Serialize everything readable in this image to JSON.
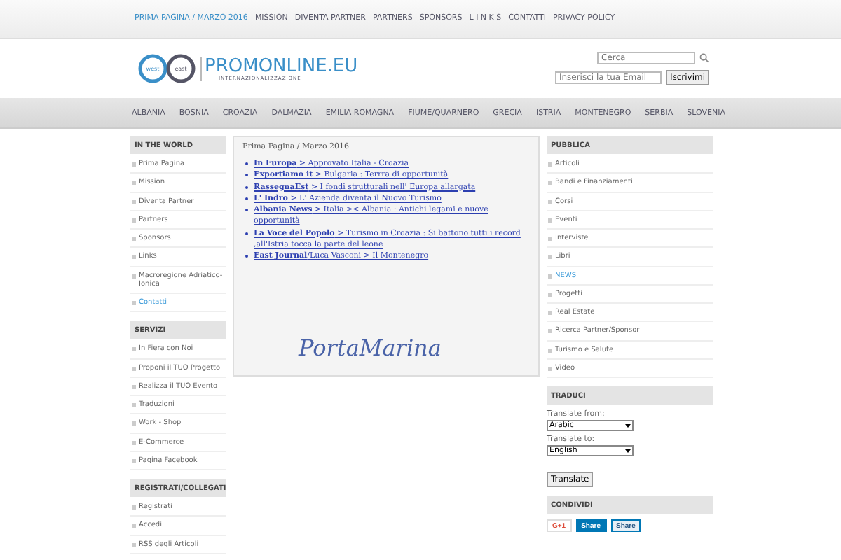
{
  "top_links": [
    {
      "label": "PRIMA PAGINA / MARZO 2016",
      "selected": true
    },
    {
      "label": "MISSION",
      "selected": false
    },
    {
      "label": "DIVENTA PARTNER",
      "selected": false
    },
    {
      "label": "PARTNERS",
      "selected": false
    },
    {
      "label": "SPONSORS",
      "selected": false
    },
    {
      "label": "L I N K S",
      "selected": false
    },
    {
      "label": "CONTATTI",
      "selected": false
    },
    {
      "label": "PRIVACY POLICY",
      "selected": false
    }
  ],
  "logo": {
    "name": "PROMONLINE.EU",
    "tagline": "INTERNAZIONALIZZAZIONE",
    "badge_left": "west",
    "badge_right": "east"
  },
  "search": {
    "placeholder": "Cerca"
  },
  "newsletter": {
    "placeholder": "Inserisci la tua Email",
    "button": "Iscrivimi"
  },
  "nav": [
    "ALBANIA",
    "BOSNIA",
    "CROAZIA",
    "DALMAZIA",
    "EMILIA ROMAGNA",
    "FIUME/QUARNERO",
    "GRECIA",
    "ISTRIA",
    "MONTENEGRO",
    "SERBIA",
    "SLOVENIA"
  ],
  "left_sections": [
    {
      "title": "IN THE WORLD",
      "items": [
        {
          "label": "Prima Pagina",
          "highlighted": false
        },
        {
          "label": "Mission",
          "highlighted": false
        },
        {
          "label": "Diventa Partner",
          "highlighted": false
        },
        {
          "label": "Partners",
          "highlighted": false
        },
        {
          "label": "Sponsors",
          "highlighted": false
        },
        {
          "label": "Links",
          "highlighted": false
        },
        {
          "label": "Macroregione Adriatico-Ionica",
          "highlighted": false
        },
        {
          "label": "Contatti",
          "highlighted": true
        }
      ]
    },
    {
      "title": "SERVIZI",
      "items": [
        {
          "label": "In Fiera con Noi",
          "highlighted": false
        },
        {
          "label": "Proponi il TUO Progetto",
          "highlighted": false
        },
        {
          "label": "Realizza il TUO Evento",
          "highlighted": false
        },
        {
          "label": "Traduzioni",
          "highlighted": false
        },
        {
          "label": "Work - Shop",
          "highlighted": false
        },
        {
          "label": "E-Commerce",
          "highlighted": false
        },
        {
          "label": "Pagina Facebook",
          "highlighted": false
        }
      ]
    },
    {
      "title": "REGISTRATI/COLLEGATI",
      "items": [
        {
          "label": "Registrati",
          "highlighted": false
        },
        {
          "label": "Accedi",
          "highlighted": false
        },
        {
          "label": "RSS degli Articoli",
          "highlighted": false
        }
      ]
    }
  ],
  "main": {
    "breadcrumb": "Prima Pagina / Marzo 2016",
    "news": [
      {
        "source": "In Europa",
        "text": " >  Approvato Italia - Croazia"
      },
      {
        "source": "Exportiamo it",
        "text": "  > Bulgaria : Terrra di opportunità"
      },
      {
        "source": "RassegnaEst",
        "text": "  >  I fondi strutturali nell' Europa allargata"
      },
      {
        "source": "L' Indro",
        "text": "  > L' Azienda diventa il Nuovo Turismo"
      },
      {
        "source": "Albania  News",
        "text": "   >  Italia ><  Albania  : Antichi legami e nuove opportunità"
      },
      {
        "source": "La Voce del Popolo",
        "text": "  > Turismo in Croazia : Si battono tutti i record ,all'Istria tocca la parte del leone"
      },
      {
        "source": "East Journal",
        "text": "/Luca Vasconi  >  Il Montenegro"
      }
    ],
    "signature": "PortaMarina"
  },
  "right": {
    "title": "PUBBLICA",
    "items": [
      {
        "label": "Articoli",
        "highlighted": false
      },
      {
        "label": "Bandi e Finanziamenti",
        "highlighted": false
      },
      {
        "label": "Corsi",
        "highlighted": false
      },
      {
        "label": "Eventi",
        "highlighted": false
      },
      {
        "label": "Interviste",
        "highlighted": false
      },
      {
        "label": "Libri",
        "highlighted": false
      },
      {
        "label": "NEWS",
        "highlighted": true
      },
      {
        "label": "Progetti",
        "highlighted": false
      },
      {
        "label": "Real Estate",
        "highlighted": false
      },
      {
        "label": "Ricerca Partner/Sponsor",
        "highlighted": false
      },
      {
        "label": "Turismo e Salute",
        "highlighted": false
      },
      {
        "label": "Video",
        "highlighted": false
      }
    ]
  },
  "translate": {
    "title": "TRADUCI",
    "from_label": "Translate from:",
    "from_value": "Arabic",
    "to_label": "Translate to:",
    "to_value": "English",
    "button": "Translate"
  },
  "share": {
    "title": "CONDIVIDI",
    "buttons": [
      {
        "kind": "gplus",
        "label": "G+1"
      },
      {
        "kind": "linkedin",
        "label": "Share"
      },
      {
        "kind": "vk",
        "label": "Share"
      }
    ]
  }
}
